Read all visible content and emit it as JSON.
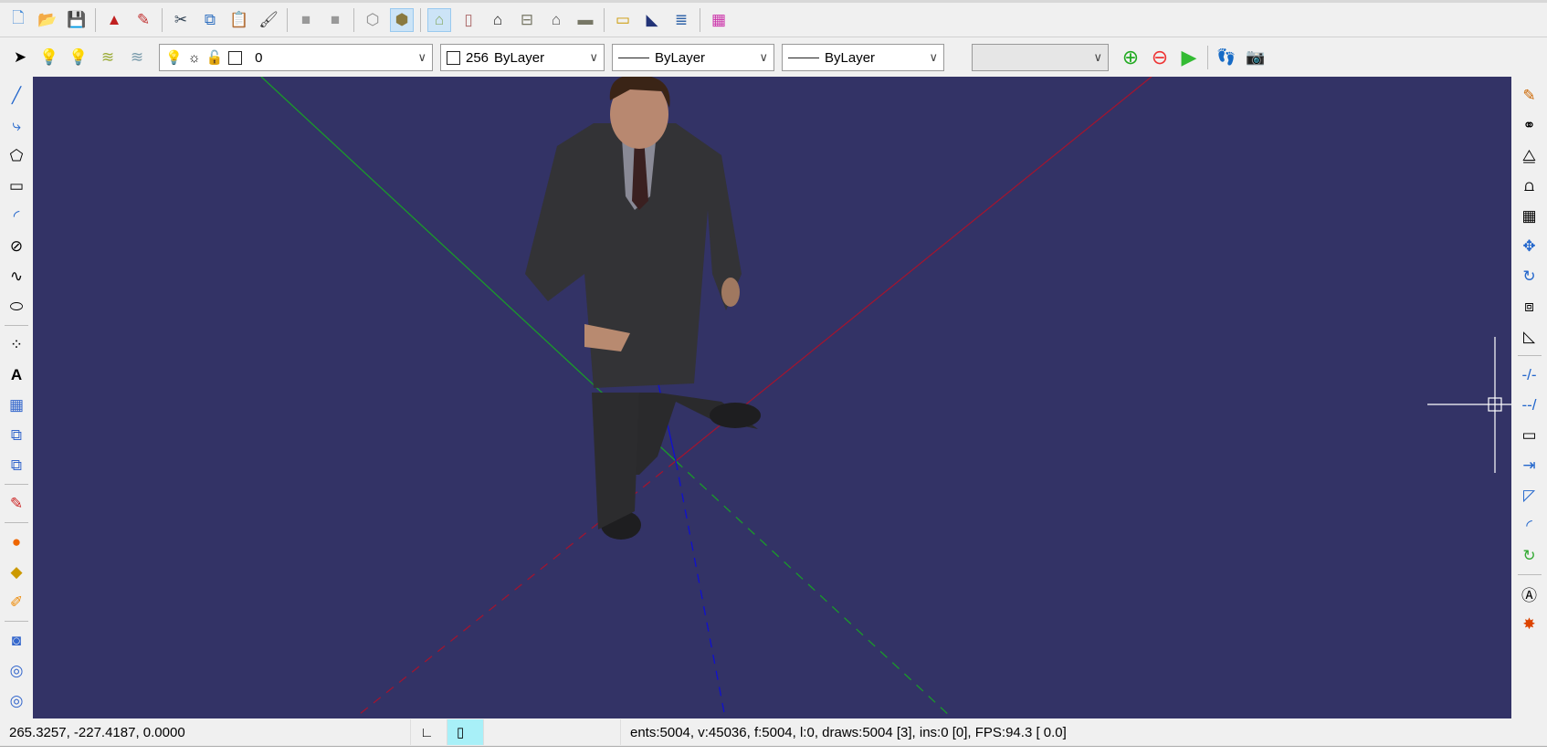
{
  "toolbar_main": {
    "groups": [
      [
        "new-icon",
        "open-icon",
        "save-icon"
      ],
      [
        "print-icon",
        "properties-icon"
      ],
      [
        "cut-icon",
        "copy-icon",
        "paste-icon",
        "brush-icon"
      ],
      [
        "undo-disabled-icon",
        "redo-disabled-icon"
      ],
      [
        "wireframe-view-icon",
        "shaded-view-icon"
      ],
      [
        "view-iso-icon",
        "view-left-icon",
        "view-front-icon",
        "view-top-icon",
        "view-back-icon",
        "view-bottom-icon"
      ],
      [
        "measure-icon",
        "area-icon",
        "script-icon"
      ],
      [
        "render-icon"
      ]
    ]
  },
  "layer_bar": {
    "layer_value": "0",
    "color_number": "256",
    "color_value": "ByLayer",
    "linetype_value": "ByLayer",
    "lineweight_value": "ByLayer",
    "extra_select_value": ""
  },
  "status": {
    "coords": "265.3257,  -227.4187,   0.0000",
    "stats": "ents:5004, v:45036, f:5004, l:0,    draws:5004 [3], ins:0 [0],    FPS:94.3 [ 0.0]"
  },
  "colors": {
    "viewport_bg": "#333366",
    "x_axis": "#a01530",
    "y_axis": "#1a9a2a",
    "z_axis": "#1010d0",
    "accent_active": "#cce4f7"
  }
}
